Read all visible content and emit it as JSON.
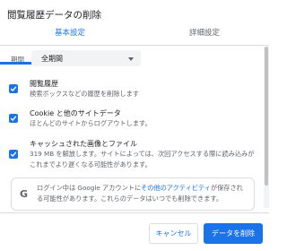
{
  "dialog": {
    "title": "閲覧履歴データの削除"
  },
  "tabs": [
    {
      "label": "基本設定",
      "active": true
    },
    {
      "label": "詳細設定",
      "active": false
    }
  ],
  "period": {
    "label": "期間",
    "selected": "全期間"
  },
  "items": [
    {
      "title": "閲覧履歴",
      "description": "検索ボックスなどの履歴を削除します",
      "checked": true
    },
    {
      "title": "Cookie と他のサイトデータ",
      "description": "ほとんどのサイトからログアウトします。",
      "checked": true
    },
    {
      "title": "キャッシュされた画像とファイル",
      "description": "319 MB を解放します。サイトによっては、次回アクセスする際に読み込みがこれまでより遅くなる可能性があります。",
      "checked": true
    }
  ],
  "info": {
    "text_before": "ログイン中は Google アカウントに",
    "link": "その他のアクティビティ",
    "text_after": "が保存される可能性があります。これらのデータはいつでも削除できます。"
  },
  "buttons": {
    "cancel": "キャンセル",
    "delete": "データを削除"
  },
  "colors": {
    "accent": "#1a73e8",
    "text": "#202124",
    "secondary_text": "#5f6368",
    "divider": "#dadce0"
  }
}
